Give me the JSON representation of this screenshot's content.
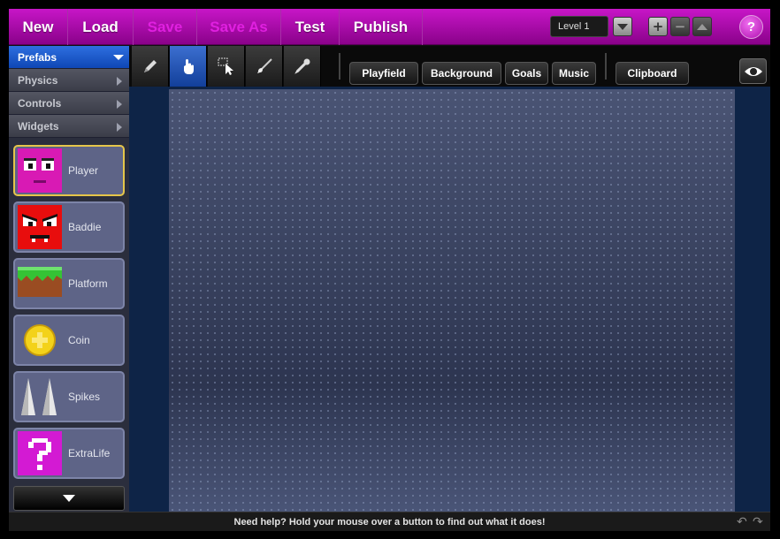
{
  "menu": {
    "new_label": "New",
    "load_label": "Load",
    "save_label": "Save",
    "save_as_label": "Save As",
    "test_label": "Test",
    "publish_label": "Publish"
  },
  "level": {
    "selected": "Level 1"
  },
  "level_buttons": {
    "add_icon": "plus-icon",
    "remove_icon": "minus-icon",
    "up_icon": "arrow-up-icon"
  },
  "help_label": "?",
  "sidebar": {
    "categories": [
      {
        "label": "Prefabs",
        "active": true
      },
      {
        "label": "Physics",
        "active": false
      },
      {
        "label": "Controls",
        "active": false
      },
      {
        "label": "Widgets",
        "active": false
      }
    ],
    "prefabs": [
      {
        "label": "Player",
        "selected": true
      },
      {
        "label": "Baddie",
        "selected": false
      },
      {
        "label": "Platform",
        "selected": false
      },
      {
        "label": "Coin",
        "selected": false
      },
      {
        "label": "Spikes",
        "selected": false
      },
      {
        "label": "ExtraLife",
        "selected": false
      }
    ]
  },
  "toolbar": {
    "tools": [
      "pencil-icon",
      "hand-icon",
      "select-icon",
      "brush-icon",
      "eyedropper-icon"
    ],
    "active_tool": "hand-icon",
    "tabs": {
      "playfield": "Playfield",
      "background": "Background",
      "goals": "Goals",
      "music": "Music",
      "clipboard": "Clipboard"
    }
  },
  "status": {
    "help_text": "Need help? Hold your mouse over a button to find out what it does!"
  },
  "colors": {
    "accent": "#b40cb4",
    "selected_border": "#e6c64a",
    "active_tool": "#2a5cc0",
    "playfield": "#3f4966"
  }
}
